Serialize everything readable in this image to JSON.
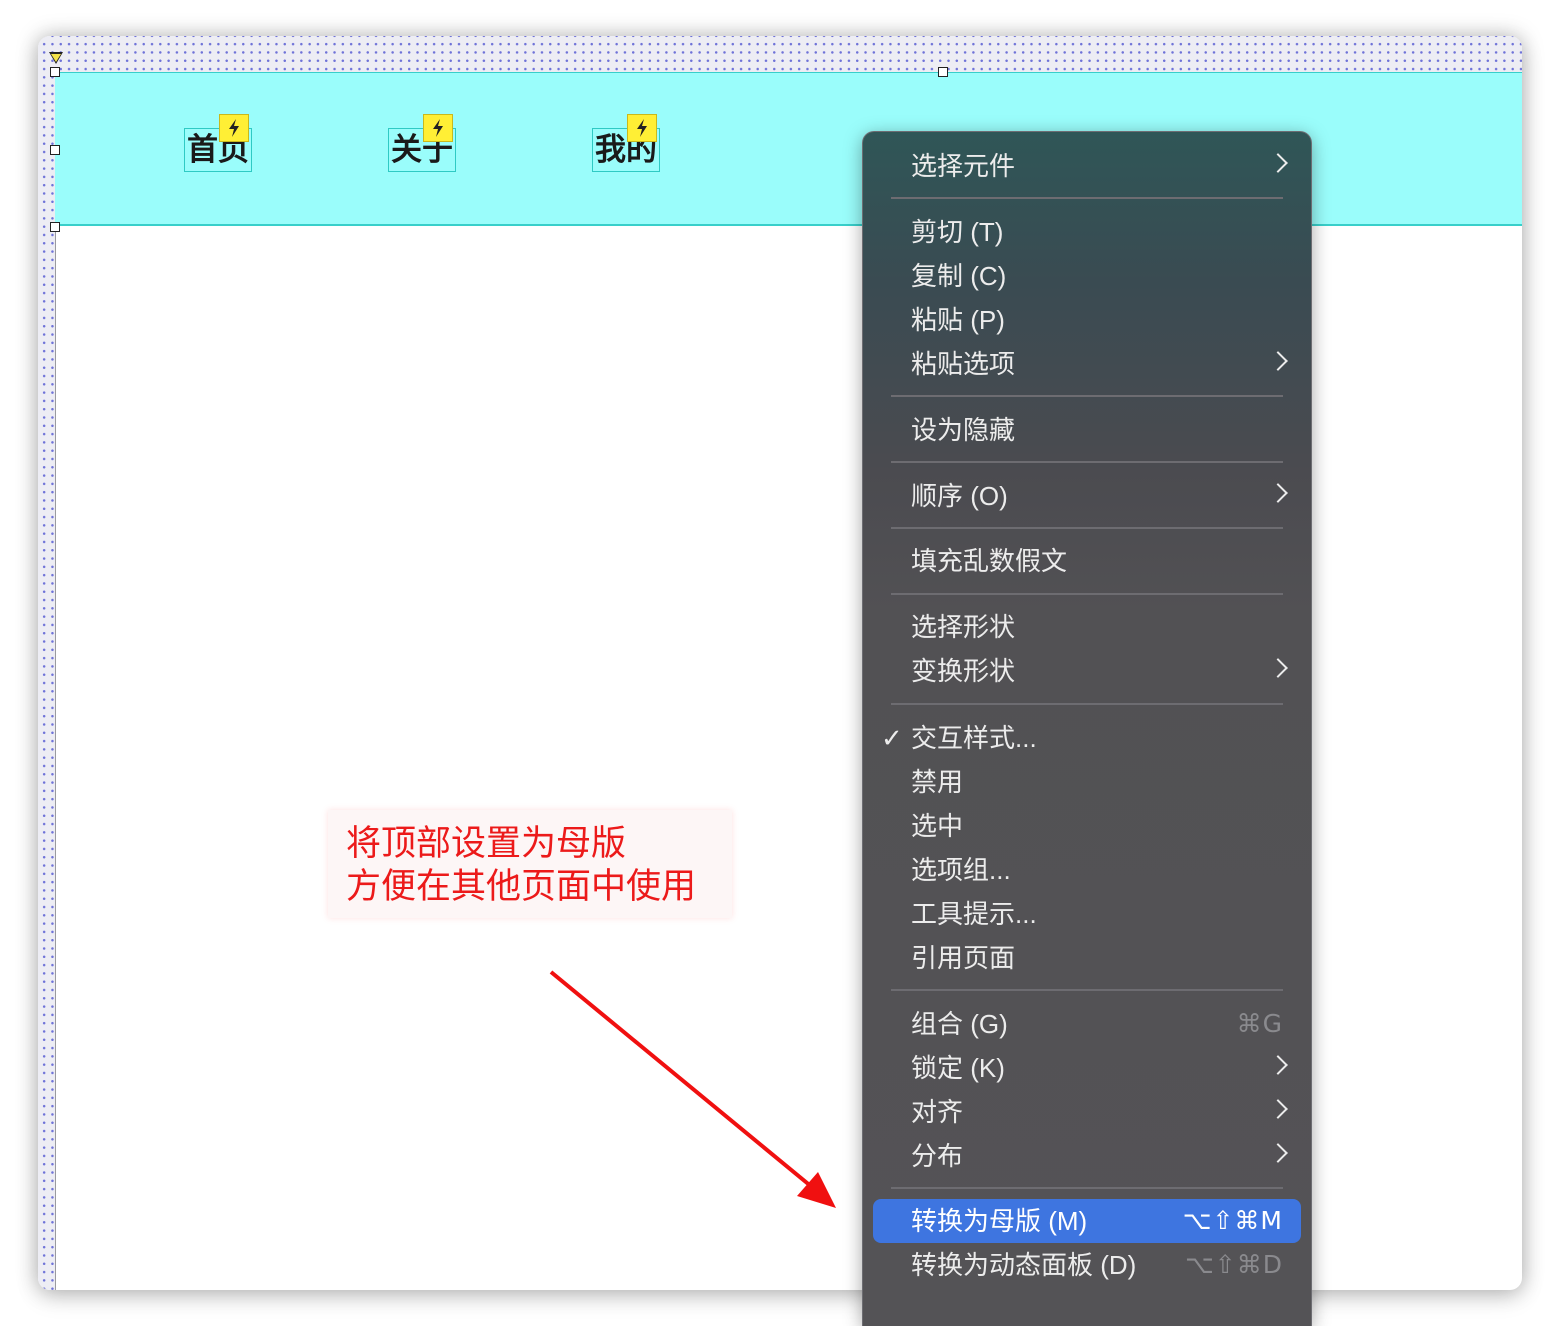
{
  "nav": [
    {
      "label": "首页"
    },
    {
      "label": "关于"
    },
    {
      "label": "我的"
    }
  ],
  "annotation": {
    "line1": "将顶部设置为母版",
    "line2": "方便在其他页面中使用"
  },
  "menu": {
    "select_element": "选择元件",
    "cut": "剪切 (T)",
    "copy": "复制 (C)",
    "paste": "粘贴 (P)",
    "paste_options": "粘贴选项",
    "set_hidden": "设为隐藏",
    "order": "顺序 (O)",
    "fill_lorem": "填充乱数假文",
    "select_shape": "选择形状",
    "transform_shape": "变换形状",
    "interaction_styles_check": "✓",
    "interaction_styles": "交互样式...",
    "disable": "禁用",
    "selected": "选中",
    "option_group": "选项组...",
    "tooltip": "工具提示...",
    "reference_page": "引用页面",
    "group": "组合 (G)",
    "group_shortcut": "⌘G",
    "lock": "锁定 (K)",
    "align": "对齐",
    "distribute": "分布",
    "convert_master": "转换为母版 (M)",
    "convert_master_shortcut": "⌥⇧⌘M",
    "convert_dynamic_panel": "转换为动态面板 (D)",
    "convert_dynamic_panel_shortcut": "⌥⇧⌘D"
  },
  "colors": {
    "header_band": "#9afdfb",
    "menu_highlight": "#3e75e0",
    "annotation_text": "#ec1a1a",
    "interaction_badge": "#ffef35"
  }
}
